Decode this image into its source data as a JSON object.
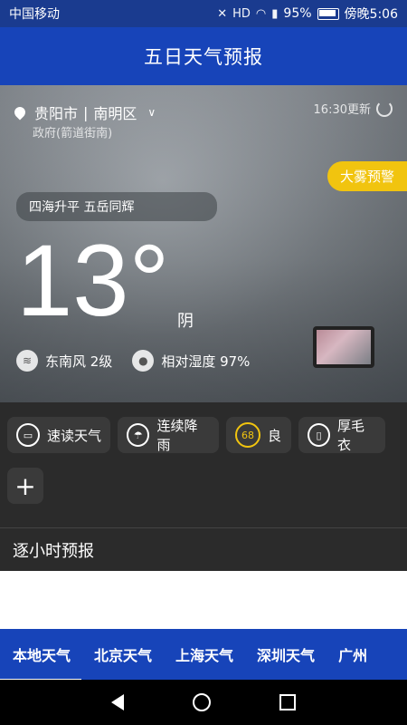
{
  "statusbar": {
    "carrier": "中国移动",
    "battery": "95%",
    "time": "傍晚5:06",
    "icons": [
      "mute-icon",
      "hd-icon",
      "wifi-icon",
      "4g-icon",
      "signal-icon",
      "battery-icon"
    ]
  },
  "header": {
    "title": "五日天气预报"
  },
  "location": {
    "city": "贵阳市",
    "separator": "|",
    "district": "南明区",
    "sub": "政府(箭道街南)"
  },
  "update_text": "16:30更新",
  "alert": "大雾预警",
  "slogan": "四海升平 五岳同辉",
  "temperature": "13°",
  "condition": "阴",
  "metrics": {
    "wind": "东南风 2级",
    "humidity": "相对湿度 97%"
  },
  "chips": {
    "quick_read": "速读天气",
    "rain": "连续降雨",
    "aqi_value": "68",
    "aqi_label": "良",
    "clothing": "厚毛衣",
    "add": "+"
  },
  "hourly": {
    "title": "逐小时预报"
  },
  "tabs": [
    "本地天气",
    "北京天气",
    "上海天气",
    "深圳天气",
    "广州"
  ],
  "colors": {
    "header_blue": "#1744b9",
    "alert_yellow": "#f1c40f",
    "chip_bg": "#3a3a3a"
  }
}
